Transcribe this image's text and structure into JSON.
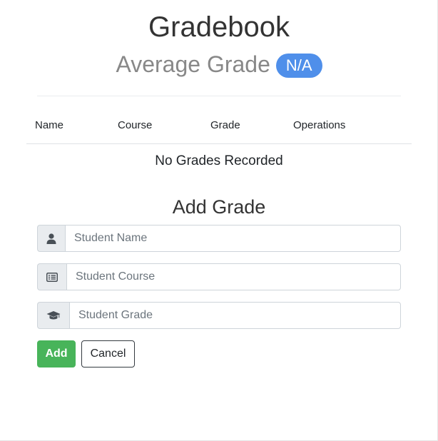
{
  "header": {
    "title": "Gradebook",
    "average_label": "Average Grade",
    "average_value": "N/A"
  },
  "table": {
    "columns": [
      "Name",
      "Course",
      "Grade",
      "Operations"
    ],
    "rows": [],
    "empty_message": "No Grades Recorded"
  },
  "form": {
    "title": "Add Grade",
    "fields": [
      {
        "icon": "user-icon",
        "placeholder": "Student Name",
        "value": ""
      },
      {
        "icon": "list-icon",
        "placeholder": "Student Course",
        "value": ""
      },
      {
        "icon": "graduation-cap-icon",
        "placeholder": "Student Grade",
        "value": ""
      }
    ],
    "add_label": "Add",
    "cancel_label": "Cancel"
  },
  "colors": {
    "badge": "#4f8fea",
    "add_button": "#48b45a",
    "addon_background": "#e9ecef"
  }
}
